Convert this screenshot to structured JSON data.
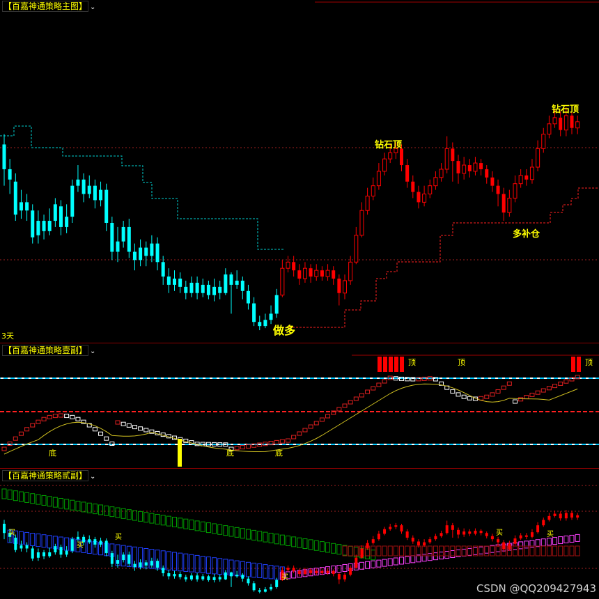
{
  "main": {
    "tab_label": "【百嘉神通策略主图】",
    "period": "3天",
    "annotations": {
      "diamond_top_1": "钻石顶",
      "diamond_top_2": "钻石顶",
      "go_long": "做多",
      "add_long": "多补仓"
    }
  },
  "sub1": {
    "tab_label": "【百嘉神通策略壹副】",
    "bottom_labels": [
      "底",
      "底",
      "底"
    ],
    "top_labels": [
      "顶",
      "顶",
      "顶"
    ]
  },
  "sub2": {
    "tab_label": "【百嘉神通策略贰副】",
    "buy_labels": [
      "买",
      "买",
      "买",
      "买",
      "买",
      "买"
    ]
  },
  "watermark": "CSDN @QQ209427943",
  "colors": {
    "up_candle": "#ff0000",
    "down_candle": "#00ffff",
    "dashed_cyan": "#00d0d0",
    "dashed_red": "#ff2020",
    "label_yellow": "#ffff00",
    "sub_line": "#d0c020",
    "green_band": "#00a000",
    "magenta": "#ff40ff",
    "blue_band": "#2040ff"
  },
  "chart_data": {
    "type": "candlestick",
    "series": [
      {
        "name": "",
        "ohlc_relative": [
          [
            0.92,
            0.8,
            0.97,
            0.72
          ],
          [
            0.8,
            0.75,
            0.85,
            0.68
          ],
          [
            0.74,
            0.58,
            0.78,
            0.55
          ],
          [
            0.6,
            0.64,
            0.7,
            0.56
          ],
          [
            0.64,
            0.6,
            0.68,
            0.55
          ],
          [
            0.6,
            0.47,
            0.63,
            0.44
          ],
          [
            0.48,
            0.55,
            0.6,
            0.44
          ],
          [
            0.55,
            0.5,
            0.58,
            0.46
          ],
          [
            0.5,
            0.55,
            0.61,
            0.48
          ],
          [
            0.55,
            0.63,
            0.66,
            0.52
          ],
          [
            0.62,
            0.52,
            0.65,
            0.48
          ],
          [
            0.52,
            0.57,
            0.63,
            0.49
          ],
          [
            0.57,
            0.72,
            0.75,
            0.54
          ],
          [
            0.72,
            0.75,
            0.82,
            0.69
          ],
          [
            0.75,
            0.68,
            0.78,
            0.64
          ],
          [
            0.68,
            0.72,
            0.77,
            0.66
          ],
          [
            0.72,
            0.65,
            0.75,
            0.61
          ],
          [
            0.65,
            0.7,
            0.74,
            0.62
          ],
          [
            0.7,
            0.54,
            0.73,
            0.5
          ],
          [
            0.54,
            0.4,
            0.57,
            0.36
          ],
          [
            0.4,
            0.45,
            0.52,
            0.35
          ],
          [
            0.45,
            0.52,
            0.55,
            0.42
          ],
          [
            0.52,
            0.4,
            0.56,
            0.37
          ],
          [
            0.4,
            0.36,
            0.44,
            0.31
          ],
          [
            0.36,
            0.42,
            0.46,
            0.33
          ],
          [
            0.42,
            0.38,
            0.45,
            0.33
          ],
          [
            0.38,
            0.44,
            0.48,
            0.35
          ],
          [
            0.44,
            0.35,
            0.47,
            0.31
          ],
          [
            0.35,
            0.28,
            0.38,
            0.24
          ],
          [
            0.28,
            0.24,
            0.32,
            0.2
          ],
          [
            0.24,
            0.27,
            0.31,
            0.21
          ],
          [
            0.27,
            0.23,
            0.3,
            0.2
          ],
          [
            0.23,
            0.2,
            0.26,
            0.17
          ],
          [
            0.2,
            0.25,
            0.28,
            0.18
          ],
          [
            0.25,
            0.2,
            0.28,
            0.17
          ],
          [
            0.2,
            0.24,
            0.27,
            0.18
          ],
          [
            0.24,
            0.19,
            0.26,
            0.17
          ],
          [
            0.19,
            0.23,
            0.27,
            0.16
          ],
          [
            0.23,
            0.2,
            0.26,
            0.17
          ],
          [
            0.2,
            0.29,
            0.32,
            0.19
          ],
          [
            0.29,
            0.24,
            0.3,
            0.1
          ],
          [
            0.24,
            0.26,
            0.31,
            0.22
          ],
          [
            0.26,
            0.21,
            0.28,
            0.17
          ],
          [
            0.21,
            0.15,
            0.24,
            0.12
          ],
          [
            0.15,
            0.06,
            0.18,
            0.04
          ],
          [
            0.06,
            0.04,
            0.09,
            0.02
          ],
          [
            0.04,
            0.07,
            0.1,
            0.03
          ],
          [
            0.07,
            0.1,
            0.14,
            0.05
          ],
          [
            0.1,
            0.19,
            0.22,
            0.08
          ],
          [
            0.19,
            0.32,
            0.36,
            0.18
          ],
          [
            0.32,
            0.35,
            0.38,
            0.3
          ],
          [
            0.35,
            0.31,
            0.38,
            0.28
          ],
          [
            0.31,
            0.27,
            0.34,
            0.24
          ],
          [
            0.27,
            0.32,
            0.35,
            0.25
          ],
          [
            0.32,
            0.28,
            0.34,
            0.25
          ],
          [
            0.28,
            0.31,
            0.34,
            0.26
          ],
          [
            0.31,
            0.28,
            0.33,
            0.26
          ],
          [
            0.28,
            0.31,
            0.34,
            0.26
          ],
          [
            0.31,
            0.27,
            0.33,
            0.24
          ],
          [
            0.27,
            0.2,
            0.29,
            0.14
          ],
          [
            0.2,
            0.26,
            0.29,
            0.17
          ],
          [
            0.26,
            0.35,
            0.38,
            0.24
          ],
          [
            0.35,
            0.48,
            0.52,
            0.34
          ],
          [
            0.48,
            0.6,
            0.64,
            0.47
          ],
          [
            0.6,
            0.67,
            0.71,
            0.58
          ],
          [
            0.67,
            0.72,
            0.76,
            0.65
          ],
          [
            0.72,
            0.79,
            0.83,
            0.7
          ],
          [
            0.79,
            0.85,
            0.88,
            0.77
          ],
          [
            0.85,
            0.88,
            0.92,
            0.83
          ],
          [
            0.88,
            0.9,
            0.93,
            0.85
          ],
          [
            0.9,
            0.82,
            0.92,
            0.79
          ],
          [
            0.82,
            0.74,
            0.85,
            0.71
          ],
          [
            0.74,
            0.69,
            0.77,
            0.66
          ],
          [
            0.69,
            0.64,
            0.72,
            0.61
          ],
          [
            0.64,
            0.68,
            0.72,
            0.62
          ],
          [
            0.68,
            0.72,
            0.75,
            0.66
          ],
          [
            0.72,
            0.76,
            0.79,
            0.7
          ],
          [
            0.76,
            0.8,
            0.83,
            0.74
          ],
          [
            0.8,
            0.9,
            0.96,
            0.78
          ],
          [
            0.9,
            0.84,
            0.93,
            0.74
          ],
          [
            0.84,
            0.78,
            0.87,
            0.73
          ],
          [
            0.78,
            0.82,
            0.86,
            0.75
          ],
          [
            0.82,
            0.79,
            0.85,
            0.76
          ],
          [
            0.79,
            0.83,
            0.86,
            0.77
          ],
          [
            0.83,
            0.8,
            0.85,
            0.77
          ],
          [
            0.8,
            0.76,
            0.82,
            0.73
          ],
          [
            0.76,
            0.72,
            0.79,
            0.69
          ],
          [
            0.72,
            0.68,
            0.75,
            0.62
          ],
          [
            0.68,
            0.59,
            0.71,
            0.55
          ],
          [
            0.59,
            0.66,
            0.7,
            0.57
          ],
          [
            0.66,
            0.73,
            0.77,
            0.64
          ],
          [
            0.73,
            0.77,
            0.8,
            0.71
          ],
          [
            0.77,
            0.75,
            0.8,
            0.72
          ],
          [
            0.75,
            0.81,
            0.85,
            0.73
          ],
          [
            0.81,
            0.9,
            0.94,
            0.79
          ],
          [
            0.9,
            0.97,
            1.0,
            0.88
          ],
          [
            0.97,
            1.02,
            1.06,
            0.95
          ],
          [
            1.02,
            1.05,
            1.09,
            1.0
          ],
          [
            1.05,
            0.99,
            1.08,
            0.96
          ],
          [
            0.99,
            1.06,
            1.1,
            0.96
          ],
          [
            1.06,
            1.0,
            1.09,
            0.97
          ],
          [
            1.0,
            1.03,
            1.06,
            0.97
          ]
        ]
      }
    ]
  }
}
